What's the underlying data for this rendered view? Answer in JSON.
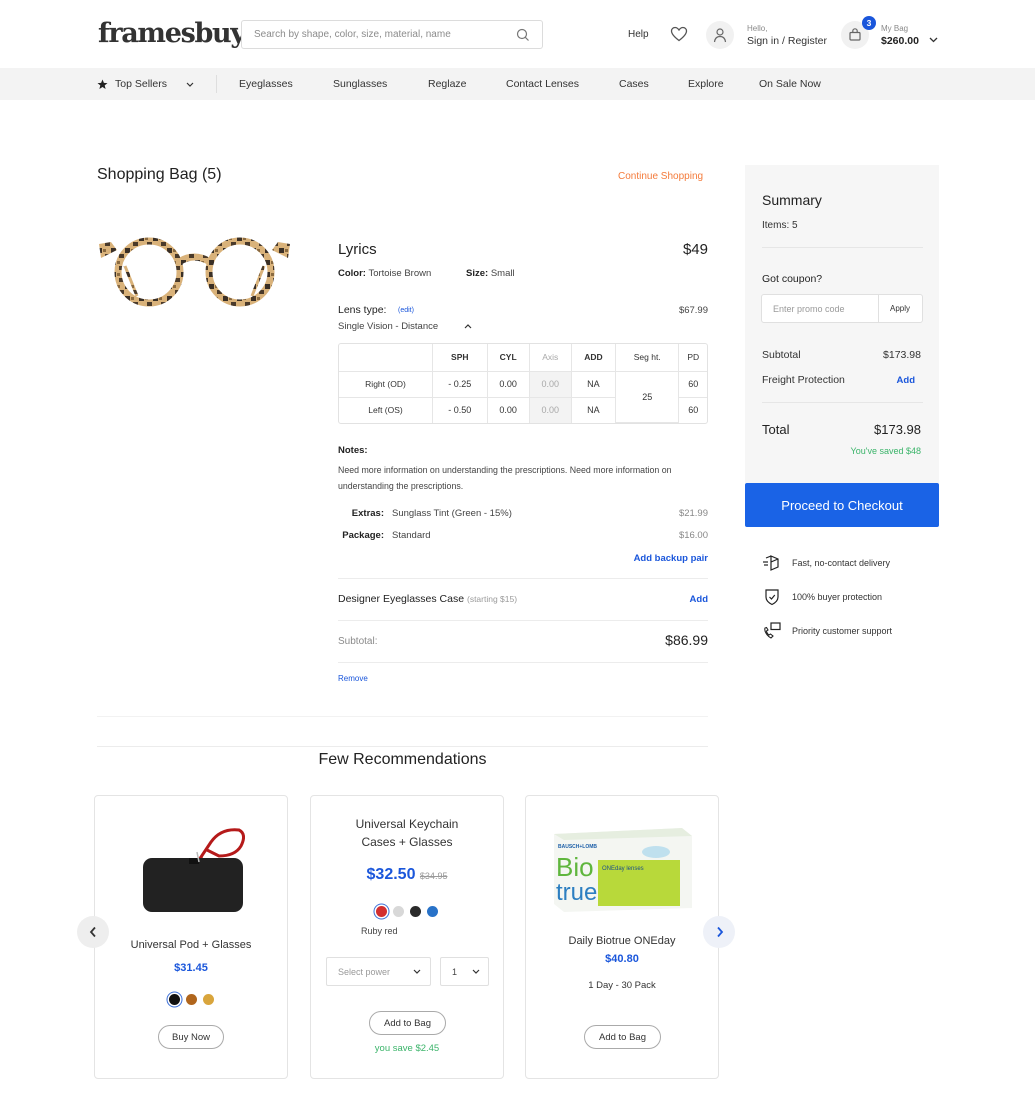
{
  "header": {
    "logo": "framesbuy",
    "search_placeholder": "Search by shape, color, size, material, name",
    "help": "Help",
    "hello": "Hello,",
    "signin": "Sign in / Register",
    "bag_count": "3",
    "bag_label": "My Bag",
    "bag_total": "$260.00",
    "icons": [
      "search-icon",
      "heart-icon",
      "user-icon",
      "bag-icon",
      "chevron-down-icon"
    ]
  },
  "nav": {
    "items": [
      "Top Sellers",
      "Eyeglasses",
      "Sunglasses",
      "Reglaze",
      "Contact Lenses",
      "Cases",
      "Explore",
      "On Sale Now"
    ],
    "accent": "#f47b3b"
  },
  "bag": {
    "title": "Shopping Bag (5)",
    "continue_label": "Continue Shopping",
    "item": {
      "name": "Lyrics",
      "price": "$49",
      "color_label": "Color:",
      "color_value": "Tortoise Brown",
      "size_label": "Size:",
      "size_value": "Small",
      "lens_label": "Lens type:",
      "lens_edit": "(edit)",
      "lens_price": "$67.99",
      "lens_value": "Single Vision - Distance",
      "rx": {
        "headers": [
          "",
          "SPH",
          "CYL",
          "Axis",
          "ADD",
          "Seg ht.",
          "PD"
        ],
        "rows": [
          {
            "label": "Right (OD)",
            "sph": "- 0.25",
            "cyl": "0.00",
            "axis": "0.00",
            "add": "NA",
            "pd": "60"
          },
          {
            "label": "Left (OS)",
            "sph": "- 0.50",
            "cyl": "0.00",
            "axis": "0.00",
            "add": "NA",
            "pd": "60"
          }
        ],
        "seg_ht": "25"
      },
      "notes_label": "Notes:",
      "notes_text": "Need more information on understanding the prescriptions. Need more information on understanding the prescriptions.",
      "extras_label": "Extras:",
      "extras_value": "Sunglass Tint (Green - 15%)",
      "extras_price": "$21.99",
      "package_label": "Package:",
      "package_value": "Standard",
      "package_price": "$16.00",
      "backup_label": "Add backup pair",
      "case_label": "Designer Eyeglasses Case",
      "case_sub": "(starting $15)",
      "case_add": "Add",
      "subtotal_label": "Subtotal:",
      "subtotal_value": "$86.99",
      "remove_label": "Remove"
    }
  },
  "summary": {
    "title": "Summary",
    "items": "Items: 5",
    "coupon_label": "Got coupon?",
    "coupon_placeholder": "Enter promo code",
    "apply_label": "Apply",
    "subtotal_label": "Subtotal",
    "subtotal_value": "$173.98",
    "freight_label": "Freight Protection",
    "freight_action": "Add",
    "total_label": "Total",
    "total_value": "$173.98",
    "saved": "You've saved $48",
    "checkout_label": "Proceed to Checkout",
    "checkout_color": "#1a63e6",
    "perks": [
      "Fast, no-contact delivery",
      "100% buyer protection",
      "Priority customer support"
    ]
  },
  "recommendations": {
    "title": "Few Recommendations",
    "cards": [
      {
        "name": "Universal Pod + Glasses",
        "price": "$31.45",
        "swatches": [
          "#111111",
          "#b0651c",
          "#d9a53c"
        ],
        "selected_swatch": 0,
        "button": "Buy Now"
      },
      {
        "name_line1": "Universal Keychain",
        "name_line2": "Cases + Glasses",
        "price": "$32.50",
        "old_price": "$34.95",
        "swatches": [
          "#d32f2f",
          "#d8d8d8",
          "#2a2a2a",
          "#2872c8"
        ],
        "selected_swatch": 0,
        "swatch_label": "Ruby red",
        "power_placeholder": "Select power",
        "qty": "1",
        "button": "Add to Bag",
        "savings": "you save $2.45"
      },
      {
        "name": "Daily Biotrue ONEday",
        "price": "$40.80",
        "pack": "1 Day - 30 Pack",
        "button": "Add to Bag",
        "box_brand": "BAUSCH+LOMB",
        "box_logo1": "Bio",
        "box_logo2": "true",
        "box_tagline": "ONEday lenses"
      }
    ]
  }
}
